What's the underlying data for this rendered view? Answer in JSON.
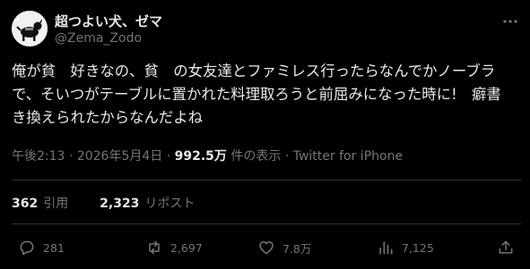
{
  "author": {
    "display_name": "超つよい犬、ゼマ",
    "handle": "@Zema_Zodo"
  },
  "tweet": {
    "lines": [
      "俺が貧　好きなの、貧　の女友達とファミレス行ったらなんでかノーブラ",
      "で、そいつがテーブルに置かれた料理取ろうと前屈みになった時に!　癖書",
      "き換えられたからなんだよね"
    ]
  },
  "meta": {
    "time": "午後2:13",
    "date": "2026年5月4日",
    "views": "992.5万",
    "views_label": "件の表示",
    "source": "Twitter for iPhone",
    "separator": "·"
  },
  "stats": {
    "quotes_count": "362",
    "quotes_label": "引用",
    "reposts_count": "2,323",
    "reposts_label": "リポスト"
  },
  "actions": {
    "replies": "281",
    "reposts": "2,697",
    "likes": "7.8万",
    "views": "7,125"
  },
  "colors": {
    "background": "#000000",
    "text": "#e7e9ea",
    "secondary": "#71767b",
    "divider": "#2f3336"
  }
}
